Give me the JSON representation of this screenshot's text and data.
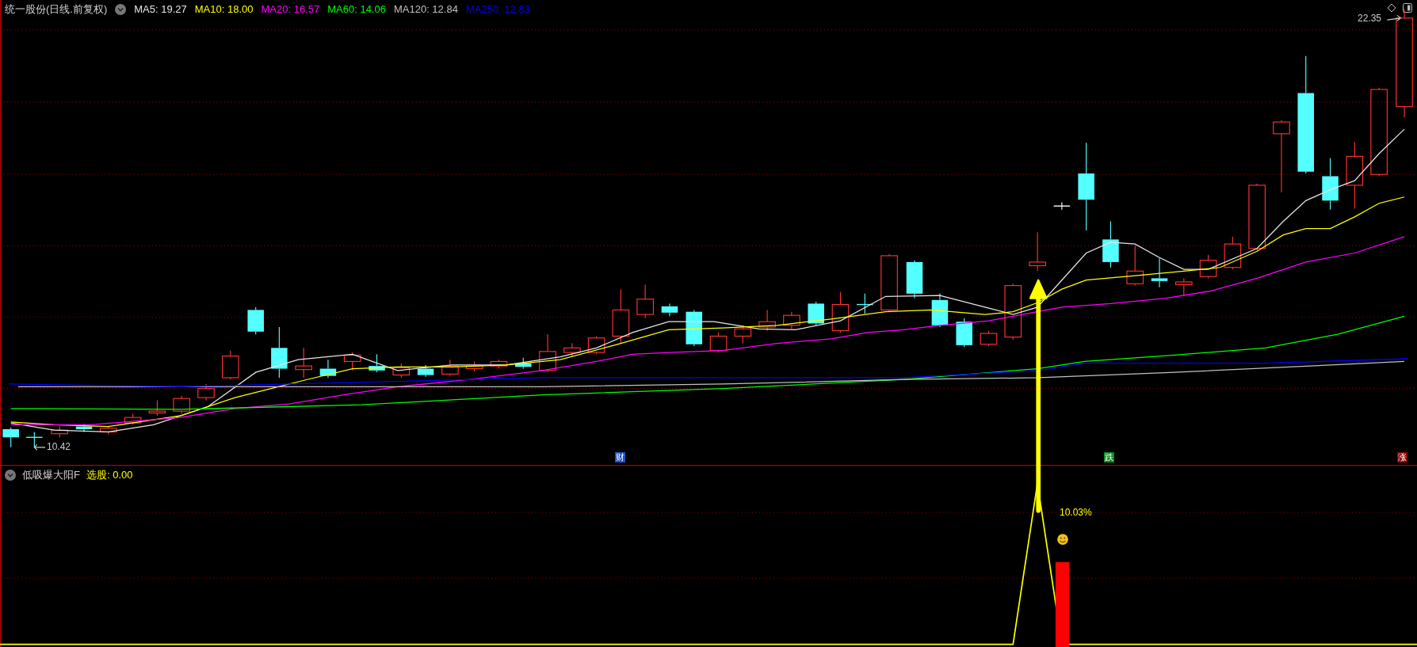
{
  "window": {
    "title": "统一股份(日线.前复权)"
  },
  "moving_averages": [
    {
      "label": "MA5:",
      "value": "19.27",
      "color": "#e6e6e6"
    },
    {
      "label": "MA10:",
      "value": "18.00",
      "color": "#ffff00"
    },
    {
      "label": "MA20:",
      "value": "16.57",
      "color": "#ff00ff"
    },
    {
      "label": "MA60:",
      "value": "14.06",
      "color": "#00ff00"
    },
    {
      "label": "MA120:",
      "value": "12.84",
      "color": "#c0c0c0"
    },
    {
      "label": "MA250:",
      "value": "12.83",
      "color": "#0000ff"
    }
  ],
  "main_chart": {
    "price_labels": [
      {
        "kind": "high",
        "text": "22.35"
      },
      {
        "kind": "low",
        "text": "10.42"
      }
    ],
    "event_markers": [
      {
        "text": "财",
        "color": "#1f4fc8"
      },
      {
        "text": "跌",
        "color": "#0a8a1e"
      },
      {
        "text": "涨",
        "color": "#8b0000"
      }
    ]
  },
  "indicator": {
    "title": "低吸爆大阳F",
    "output": "选股: 0.00",
    "signal_label": "10.03%"
  }
}
